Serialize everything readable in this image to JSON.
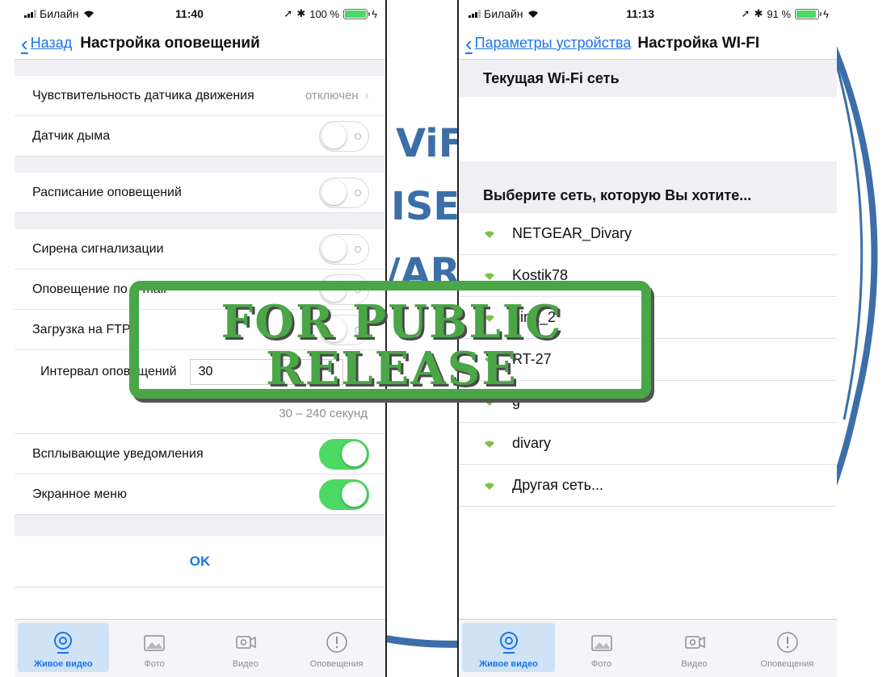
{
  "background_logo": {
    "fragments": [
      "ViFi",
      "ISE",
      "/ARY"
    ]
  },
  "left": {
    "status": {
      "carrier": "Билайн",
      "time": "11:40",
      "battery": "100 %",
      "battery_level": 1.0
    },
    "nav": {
      "back": "Назад",
      "title": "Настройка оповещений"
    },
    "rows": {
      "motion": {
        "label": "Чувствительность датчика движения",
        "value": "отключен"
      },
      "smoke": {
        "label": "Датчик дыма",
        "on": false
      },
      "schedule": {
        "label": "Расписание оповещений",
        "on": false
      },
      "siren": {
        "label": "Сирена сигнализации",
        "on": false
      },
      "email": {
        "label": "Оповещение по e-mail",
        "on": false
      },
      "ftp": {
        "label": "Загрузка на FTP",
        "on": false
      },
      "interval": {
        "label": "Интервал оповещений",
        "value": "30"
      },
      "interval_hint": "30 – 240 секунд",
      "popup": {
        "label": "Всплывающие  уведомления",
        "on": true
      },
      "screen_menu": {
        "label": "Экранное меню",
        "on": true
      }
    },
    "ok": "OK",
    "tabs": [
      {
        "label": "Живое видео",
        "icon": "live-video-icon",
        "active": true
      },
      {
        "label": "Фото",
        "icon": "photo-icon",
        "active": false
      },
      {
        "label": "Видео",
        "icon": "video-icon",
        "active": false
      },
      {
        "label": "Оповещения",
        "icon": "alert-icon",
        "active": false
      }
    ]
  },
  "right": {
    "status": {
      "carrier": "Билайн",
      "time": "11:13",
      "battery": "91 %",
      "battery_level": 0.91
    },
    "nav": {
      "back": "Параметры устройства",
      "title": "Настройка WI-FI"
    },
    "current_header": "Текущая Wi-Fi сеть",
    "choose_header": "Выберите сеть, которую Вы хотите...",
    "networks": [
      "NETGEAR_Divary",
      "Kostik78",
      "bina_2",
      "RT-27",
      "g",
      "divary",
      "Другая сеть..."
    ],
    "tabs": [
      {
        "label": "Живое видео",
        "icon": "live-video-icon",
        "active": true
      },
      {
        "label": "Фото",
        "icon": "photo-icon",
        "active": false
      },
      {
        "label": "Видео",
        "icon": "video-icon",
        "active": false
      },
      {
        "label": "Оповещения",
        "icon": "alert-icon",
        "active": false
      }
    ]
  },
  "stamp": {
    "line1": "FOR PUBLIC",
    "line2": "RELEASE",
    "color": "#4aa647"
  },
  "colors": {
    "ios_blue": "#1a74e8",
    "toggle_on": "#4cd964",
    "group_bg": "#efeff4"
  }
}
